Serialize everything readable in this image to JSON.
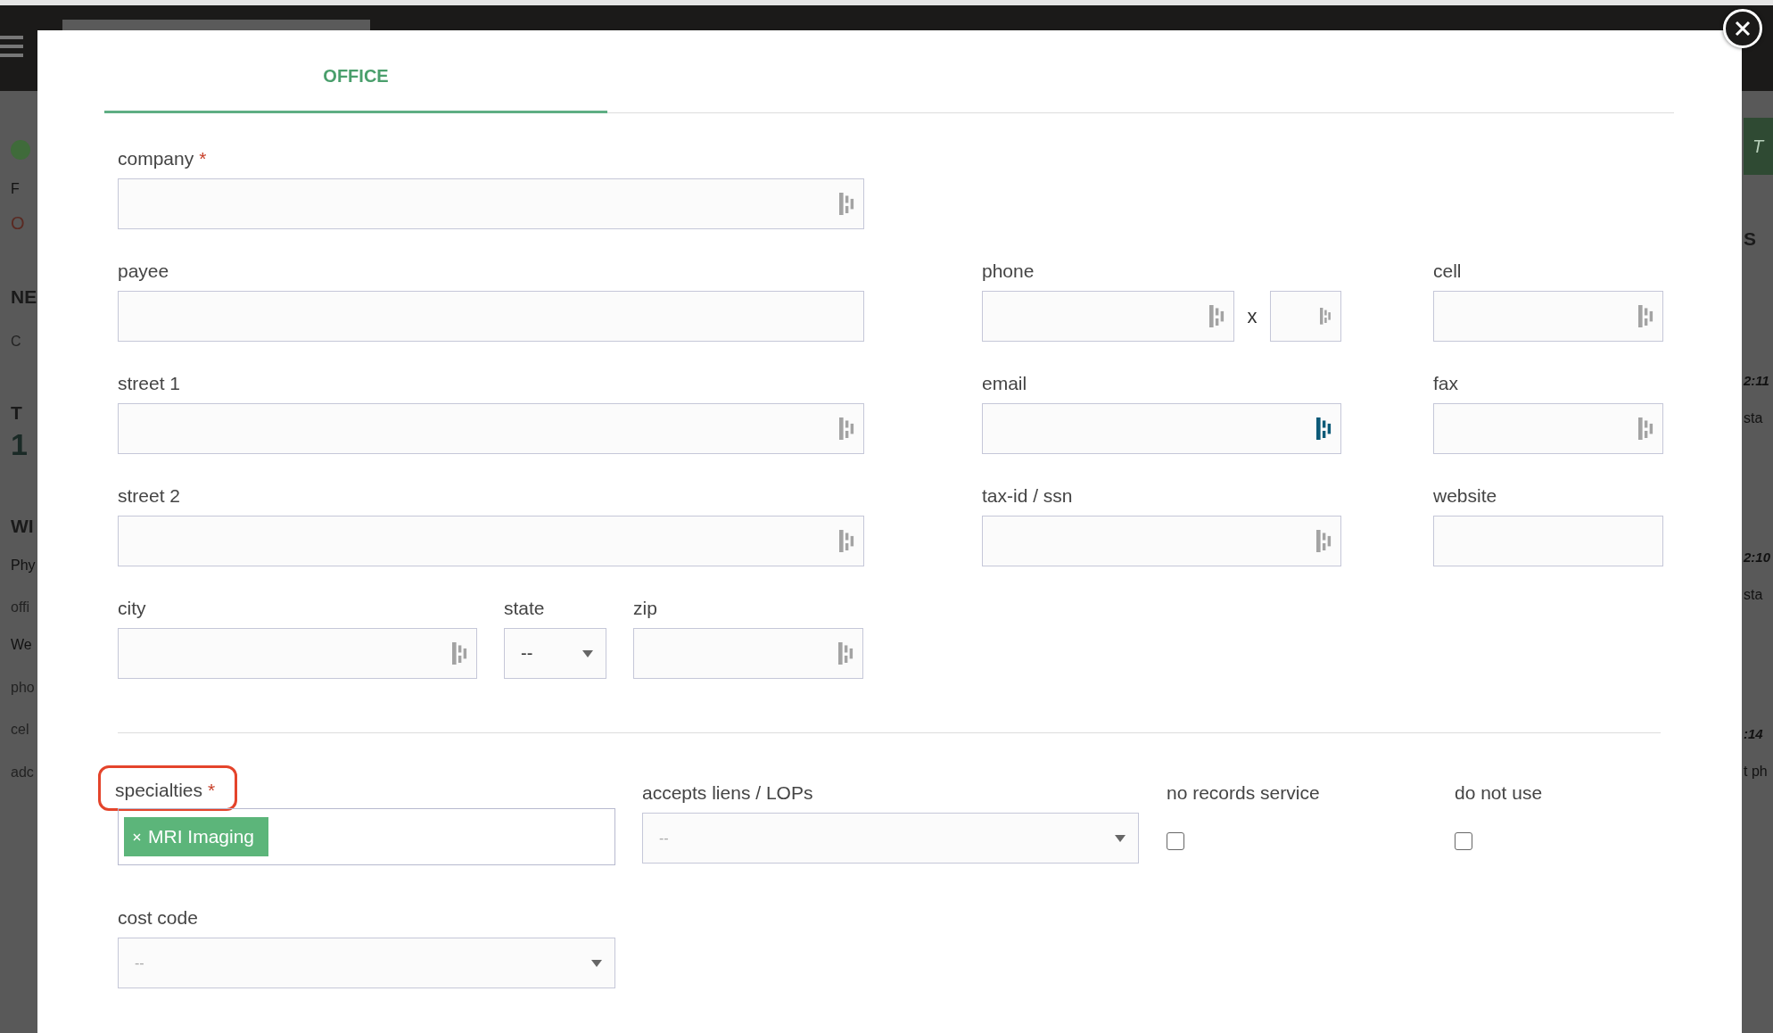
{
  "background": {
    "left": [
      {
        "kind": "dot",
        "color": "#3f6b3a"
      },
      {
        "kind": "text",
        "text": "F"
      },
      {
        "kind": "alert",
        "text": "O"
      },
      {
        "kind": "heading",
        "text": "NE"
      },
      {
        "kind": "faint",
        "text": "C"
      },
      {
        "kind": "heading",
        "text": "T"
      },
      {
        "kind": "big",
        "text": "1"
      },
      {
        "kind": "heading",
        "text": "WI"
      },
      {
        "kind": "text",
        "text": "Phy"
      },
      {
        "kind": "faint",
        "text": "offi"
      },
      {
        "kind": "text",
        "text": "We"
      },
      {
        "kind": "faint",
        "text": "pho"
      },
      {
        "kind": "faint",
        "text": "cel"
      },
      {
        "kind": "faint",
        "text": "adc"
      }
    ],
    "right": [
      {
        "kind": "banner",
        "text": "T"
      },
      {
        "kind": "heading",
        "text": "S"
      },
      {
        "kind": "time",
        "text": "2:11"
      },
      {
        "kind": "text",
        "text": "sta"
      },
      {
        "kind": "time",
        "text": "2:10"
      },
      {
        "kind": "text",
        "text": "sta"
      },
      {
        "kind": "time",
        "text": ":14"
      },
      {
        "kind": "text",
        "text": "t ph"
      }
    ]
  },
  "modal": {
    "tabs": [
      {
        "label": "OFFICE",
        "selected": true
      }
    ],
    "left": [
      {
        "label": "company",
        "required_mark": "*",
        "autofill": true,
        "autofill_active": false
      },
      {
        "label": "payee"
      },
      {
        "label": "street 1",
        "autofill": true,
        "autofill_active": false
      },
      {
        "label": "street 2",
        "autofill": true,
        "autofill_active": false
      }
    ],
    "location": [
      {
        "kind": "input",
        "label": "city",
        "autofill": true,
        "autofill_active": false
      },
      {
        "kind": "select",
        "label": "state",
        "value": "--"
      },
      {
        "kind": "input",
        "label": "zip",
        "autofill": true,
        "autofill_active": false
      }
    ],
    "middle": [
      {
        "label": "phone",
        "autofill": true,
        "autofill_active": false,
        "ext": {
          "separator": "x",
          "autofill": true,
          "autofill_active": false
        }
      },
      {
        "label": "email",
        "autofill": true,
        "autofill_active": true
      },
      {
        "label": "tax-id / ssn",
        "autofill": true,
        "autofill_active": false
      }
    ],
    "right": [
      {
        "label": "cell",
        "autofill": true,
        "autofill_active": false
      },
      {
        "label": "fax",
        "autofill": true,
        "autofill_active": false
      },
      {
        "label": "website"
      }
    ],
    "specialties": {
      "label": "specialties",
      "required_mark": "*",
      "highlighted": true,
      "tags": [
        "MRI Imaging"
      ]
    },
    "accepts": {
      "label": "accepts liens / LOPs",
      "placeholder": "--"
    },
    "checks": [
      {
        "label": "no records service",
        "checked": false
      },
      {
        "label": "do not use",
        "checked": false
      }
    ],
    "cost_code": {
      "label": "cost code",
      "placeholder": "--"
    }
  }
}
